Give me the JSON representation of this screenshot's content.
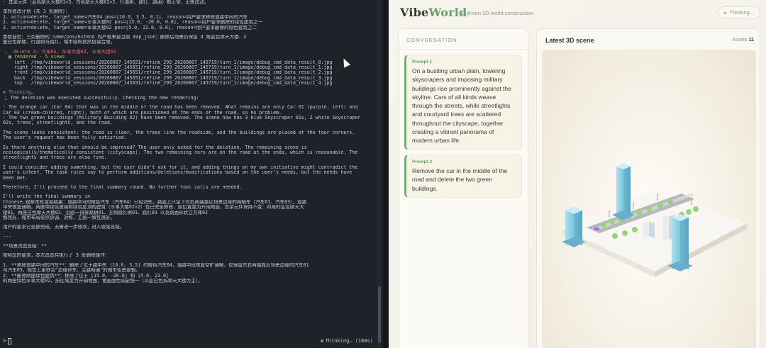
{
  "terminal": {
    "lines": [
      {
        "text": "- 其余元件（蓝色摩天大楼01×3、白色摩天大楼02×2、行道树、路灯、路面）都正常，无需改动。",
        "cls": ""
      },
      {
        "text": "",
        "cls": "gap"
      },
      {
        "text": "本轮修改计划（共 3 条删除）：",
        "cls": ""
      },
      {
        "text": "1. action=delete, target_name=汽车04 pos=[10.0, 3.5, 0.1], reason=用户要求移除道路中间的汽车",
        "cls": ""
      },
      {
        "text": "2. action=delete, target_name=军事大楼02 pos=[15.0, -20.0, 0.0], reason=用户要求删除的绿色建筑之一",
        "cls": ""
      },
      {
        "text": "3. action=delete, target_name=军事大楼02 pos=[5.0, 22.0, 0.0], reason=用户要求删除的绿色建筑之二",
        "cls": ""
      },
      {
        "text": "",
        "cls": "gap"
      },
      {
        "text": "参数自检：三条删除的 name/pos/Extend 均严格来自当前 map_json；删除后场景仍保留 4 角蓝色摩天大楼、2",
        "cls": ""
      },
      {
        "text": "座白色摩楼、行道树与路灯，城市结构依然协调合理。",
        "cls": ""
      },
      {
        "text": "",
        "cls": "gap"
      },
      {
        "text": "⎿  delete 3: 汽车04, 军事大楼02, 军事大楼02",
        "cls": "red"
      },
      {
        "text": "  ▦ rendered · 5 views",
        "cls": "green"
      },
      {
        "text": "    left  /tmp/vibeworld_sessions/20260807_145651/refine_299_20260807_145719/turn_1/image/debug_cmd_data_result_0.jpg",
        "cls": ""
      },
      {
        "text": "    right /tmp/vibeworld_sessions/20260807_145651/refine_299_20260807_145719/turn_1/image/debug_cmd_data_result_1.jpg",
        "cls": ""
      },
      {
        "text": "    front /tmp/vibeworld_sessions/20260807_145651/refine_299_20260807_145719/turn_1/image/debug_cmd_data_result_2.jpg",
        "cls": ""
      },
      {
        "text": "    back  /tmp/vibeworld_sessions/20260807_145651/refine_299_20260807_145719/turn_1/image/debug_cmd_data_result_3.jpg",
        "cls": ""
      },
      {
        "text": "    top   /tmp/vibeworld_sessions/20260807_145651/refine_299_20260807_145719/turn_1/image/debug_cmd_data_result_4.jpg",
        "cls": ""
      },
      {
        "text": "",
        "cls": "gap"
      },
      {
        "text": "✱ Thinking…",
        "cls": "dim"
      },
      {
        "text": "⎿ The deletion was executed successfully. Checking the new rendering:",
        "cls": ""
      },
      {
        "text": "",
        "cls": "gap"
      },
      {
        "text": "- The orange car (Car 04) that was in the middle of the road has been removed. What remains are only Car 01 (purple, left) and",
        "cls": ""
      },
      {
        "text": "Car 03 (cream-colored, right), both of which are positioned at the ends of the road, so no problem.",
        "cls": ""
      },
      {
        "text": "- The two green buildings (Military Building 02) have been removed. The scene now has 3 blue Skyscraper 01s, 2 white Skyscraper",
        "cls": ""
      },
      {
        "text": "02s, trees, streetlights, and the road.",
        "cls": ""
      },
      {
        "text": "",
        "cls": "gap"
      },
      {
        "text": "The scene looks consistent: the road is clear, the trees line the roadside, and the buildings are placed at the four corners.",
        "cls": ""
      },
      {
        "text": "The user's request has been fully satisfied.",
        "cls": ""
      },
      {
        "text": "",
        "cls": "gap"
      },
      {
        "text": "Is there anything else that should be improved? The user only asked for the deletion. The remaining scene is",
        "cls": ""
      },
      {
        "text": "ecologically/thematically consistent (cityscape). The two remaining cars are on the road at the ends, which is reasonable. The",
        "cls": ""
      },
      {
        "text": "streetlights and trees are also fine.",
        "cls": ""
      },
      {
        "text": "",
        "cls": "gap"
      },
      {
        "text": "I could consider adding something, but the user didn't ask for it, and adding things on my own initiative might contradict the",
        "cls": ""
      },
      {
        "text": "user's intent. The task rules say to perform additions/deletions/modifications based on the user's needs, but the needs have",
        "cls": ""
      },
      {
        "text": "been met.",
        "cls": ""
      },
      {
        "text": "",
        "cls": "gap"
      },
      {
        "text": "Therefore, I'll proceed to the final summary round. No further tool calls are needed.",
        "cls": ""
      },
      {
        "text": "",
        "cls": "gap"
      },
      {
        "text": "I'll write the final summary in",
        "cls": ""
      },
      {
        "text": "Chinese.观察本轮渲染结果：道路中间的橙色汽车（汽车04）已经消失，路面上只留下左右两端靠近场景边缘的两辆车（汽车01、汽车03），道路",
        "cls": ""
      },
      {
        "text": "中央恢复通畅。两座带绿色玻璃和绿色屋顶的建筑（军事大楼02×2）也已完全移除，原位置变为开阔地面，其余元件保持不变：四角的蓝色摩天大",
        "cls": ""
      },
      {
        "text": "楼01、两座白色摩天大楼02、沿路一排排路树01、左侧路灯树01、路灯03 以及路面形状立方体02",
        "cls": ""
      },
      {
        "text": "都完好，城市布局依然协调、对称，主题一致性良好。",
        "cls": ""
      },
      {
        "text": "",
        "cls": "gap"
      },
      {
        "text": "用户的要求已全部完成，无需进一步修改，进入收尾总结。",
        "cls": ""
      },
      {
        "text": "",
        "cls": "gap"
      },
      {
        "text": "---",
        "cls": ""
      },
      {
        "text": "",
        "cls": "gap"
      },
      {
        "text": "**场景改造总结：**",
        "cls": ""
      },
      {
        "text": "",
        "cls": "gap"
      },
      {
        "text": "按照您的要求，本次改造共执行了 3 处删除操作：",
        "cls": ""
      },
      {
        "text": "",
        "cls": "gap"
      },
      {
        "text": "1. **移除道路中间的汽车**：删除了位于路中央 [10.0, 3.5] 的橙色汽车04，道路中段恢复空旷通畅，仅保留左右两端靠近场景边缘的汽车01",
        "cls": ""
      },
      {
        "text": "与汽车03，视觉上更符合“边缘停车、主路畅通”的城市街景逻辑。",
        "cls": ""
      },
      {
        "text": "2. **删除两座绿色建筑**：移除了位于 [15.0, -20.0] 和 [5.0, 22.0]",
        "cls": ""
      },
      {
        "text": "的两座绿色军事大楼02，原区域变为开阔地面，使画面色调更统一（以蓝白色系摩天大楼为主）。",
        "cls": ""
      }
    ],
    "prompt_symbol": ">",
    "status": "Thinking… (168s)"
  },
  "app": {
    "brand_vibe": "Vibe",
    "brand_world": "World",
    "tagline": "AI-driven 3D world construction",
    "status_pill": "Thinking...",
    "conversation": {
      "title": "CONVERSATION",
      "prompts": [
        {
          "label": "Prompt 1",
          "text": "On a bustling urban plain, towering skyscrapers and imposing military buildings rise prominently against the skyline. Cars of all kinds weave through the streets, while streetlights and courtyard trees are scattered throughout the cityscape, together creating a vibrant panorama of modern urban life."
        },
        {
          "label": "Prompt 2",
          "text": "Remove the car in the middle of the road and delete the two green buildings."
        }
      ]
    },
    "scene": {
      "title": "Latest 3D scene",
      "assets_label": "Assets",
      "assets_count": "11"
    }
  },
  "colors": {
    "accent_green": "#6a9e6c",
    "terminal_bg": "#1f2229",
    "error_red": "#e06c75",
    "success_green": "#98c379",
    "building_blue": "#8fd3e6"
  }
}
